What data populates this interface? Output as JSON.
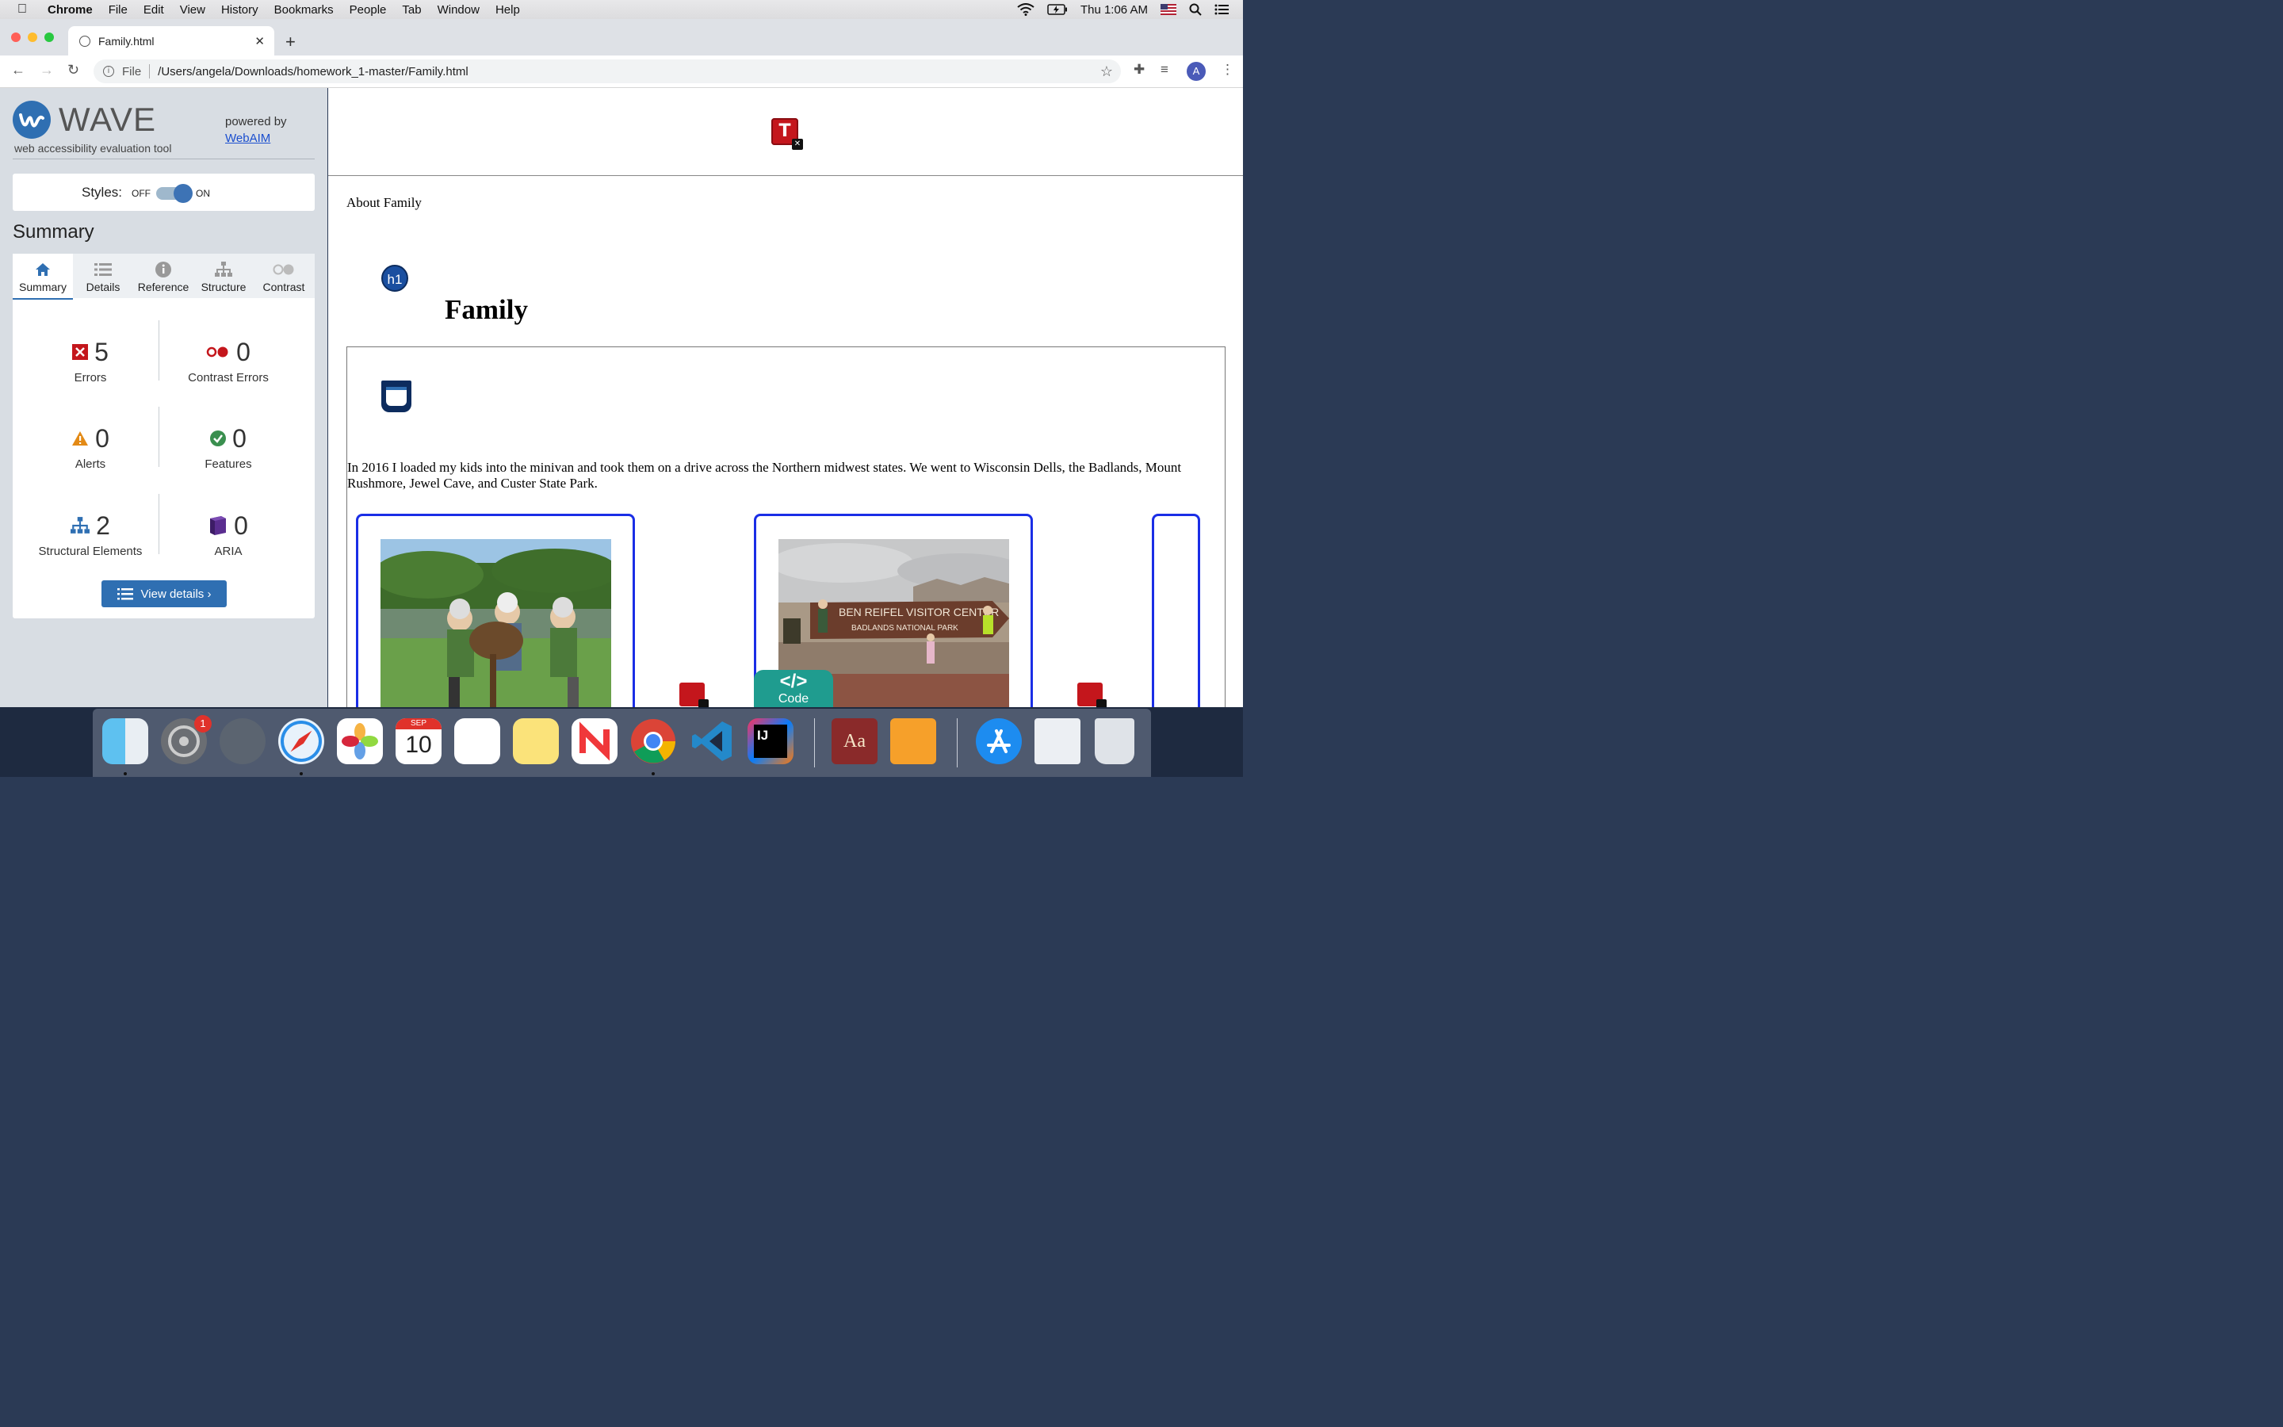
{
  "menubar": {
    "app": "Chrome",
    "items": [
      "File",
      "Edit",
      "View",
      "History",
      "Bookmarks",
      "People",
      "Tab",
      "Window",
      "Help"
    ],
    "clock": "Thu 1:06 AM"
  },
  "browser": {
    "tab_title": "Family.html",
    "url_scheme": "File",
    "url_path": "/Users/angela/Downloads/homework_1-master/Family.html",
    "profile_initial": "A"
  },
  "wave": {
    "title": "WAVE",
    "subtitle": "web accessibility evaluation tool",
    "powered_by": "powered by",
    "webaim": "WebAIM",
    "styles_label": "Styles:",
    "off": "OFF",
    "on": "ON",
    "summary_heading": "Summary",
    "tabs": [
      {
        "label": "Summary",
        "icon": "home-icon"
      },
      {
        "label": "Details",
        "icon": "list-icon"
      },
      {
        "label": "Reference",
        "icon": "info-icon"
      },
      {
        "label": "Structure",
        "icon": "hierarchy-icon"
      },
      {
        "label": "Contrast",
        "icon": "contrast-icon"
      }
    ],
    "stats": {
      "errors": {
        "value": "5",
        "label": "Errors"
      },
      "contrast": {
        "value": "0",
        "label": "Contrast Errors"
      },
      "alerts": {
        "value": "0",
        "label": "Alerts"
      },
      "features": {
        "value": "0",
        "label": "Features"
      },
      "structural": {
        "value": "2",
        "label": "Structural Elements"
      },
      "aria": {
        "value": "0",
        "label": "ARIA"
      }
    },
    "view_details": "View details ›"
  },
  "page": {
    "t_badge": "T",
    "about": "About Family",
    "h1_badge": "h1",
    "heading": "Family",
    "paragraph": "In 2016 I loaded my kids into the minivan and took them on a drive across the Northern midwest states. We went to Wisconsin Dells, the Badlands, Mount Rushmore, Jewel Cave, and Custer State Park.",
    "code_symbol": "</>",
    "code_label": "Code",
    "sign_line1": "BEN REIFEL VISITOR CENTER",
    "sign_line2": "BADLANDS NATIONAL PARK"
  },
  "dock": {
    "calendar_month": "SEP",
    "calendar_day": "10",
    "prefs_badge": "1"
  }
}
